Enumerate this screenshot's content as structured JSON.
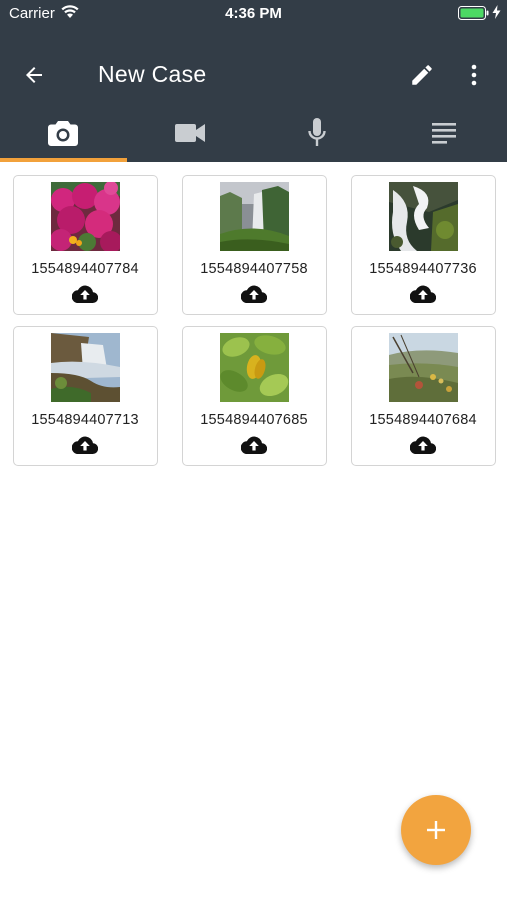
{
  "status_bar": {
    "carrier": "Carrier",
    "time": "4:36 PM"
  },
  "appbar": {
    "title": "New Case"
  },
  "tabs": [
    {
      "icon": "camera-icon",
      "selected": true
    },
    {
      "icon": "videocam-icon",
      "selected": false
    },
    {
      "icon": "microphone-icon",
      "selected": false
    },
    {
      "icon": "notes-icon",
      "selected": false
    }
  ],
  "colors": {
    "header": "#333d47",
    "accent": "#f2a13b",
    "fab": "#f2a43f"
  },
  "items": [
    {
      "label": "1554894407784",
      "image": "magenta-flowers",
      "icon": "cloud-upload-icon"
    },
    {
      "label": "1554894407758",
      "image": "waterfall-valley",
      "icon": "cloud-upload-icon"
    },
    {
      "label": "1554894407736",
      "image": "cascade-rocks",
      "icon": "cloud-upload-icon"
    },
    {
      "label": "1554894407713",
      "image": "waterfall-cliff",
      "icon": "cloud-upload-icon"
    },
    {
      "label": "1554894407685",
      "image": "green-leaves",
      "icon": "cloud-upload-icon"
    },
    {
      "label": "1554894407684",
      "image": "hillside-plants",
      "icon": "cloud-upload-icon"
    }
  ]
}
